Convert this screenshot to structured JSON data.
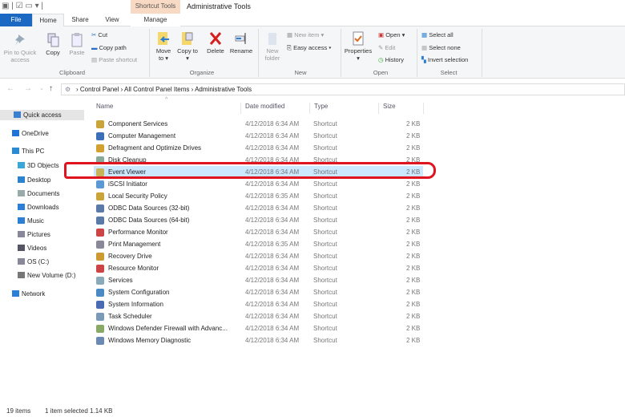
{
  "window": {
    "title": "Administrative Tools",
    "context_tab_group": "Shortcut Tools"
  },
  "tabs": [
    "File",
    "Home",
    "Share",
    "View",
    "Manage"
  ],
  "ribbon": {
    "clipboard": {
      "pin": "Pin to Quick access",
      "copy": "Copy",
      "paste": "Paste",
      "cut": "Cut",
      "copy_path": "Copy path",
      "paste_shortcut": "Paste shortcut",
      "group": "Clipboard"
    },
    "organize": {
      "move_to": "Move to ▾",
      "copy_to": "Copy to ▾",
      "delete": "Delete",
      "rename": "Rename",
      "group": "Organize"
    },
    "new": {
      "new_folder": "New folder",
      "new_item": "New item ▾",
      "easy_access": "Easy access ▾",
      "group": "New"
    },
    "open": {
      "properties": "Properties",
      "open": "Open ▾",
      "edit": "Edit",
      "history": "History",
      "group": "Open"
    },
    "select": {
      "select_all": "Select all",
      "select_none": "Select none",
      "invert": "Invert selection",
      "group": "Select"
    }
  },
  "address": {
    "crumbs": [
      "Control Panel",
      "All Control Panel Items",
      "Administrative Tools"
    ]
  },
  "nav": [
    {
      "label": "Quick access",
      "icon": "star-icon",
      "color": "#3b7fd1",
      "indent": 0
    },
    {
      "label": "OneDrive",
      "icon": "cloud-icon",
      "color": "#1e73d6",
      "indent": 0
    },
    {
      "label": "This PC",
      "icon": "computer-icon",
      "color": "#2a8ad4",
      "indent": 0
    },
    {
      "label": "3D Objects",
      "icon": "cube-icon",
      "color": "#3aa7d8",
      "indent": 1
    },
    {
      "label": "Desktop",
      "icon": "desktop-icon",
      "color": "#2b83d0",
      "indent": 1
    },
    {
      "label": "Documents",
      "icon": "document-icon",
      "color": "#9aa",
      "indent": 1
    },
    {
      "label": "Downloads",
      "icon": "download-icon",
      "color": "#2b7fd6",
      "indent": 1
    },
    {
      "label": "Music",
      "icon": "music-icon",
      "color": "#2b7fd6",
      "indent": 1
    },
    {
      "label": "Pictures",
      "icon": "pictures-icon",
      "color": "#889",
      "indent": 1
    },
    {
      "label": "Videos",
      "icon": "video-icon",
      "color": "#556",
      "indent": 1
    },
    {
      "label": "OS (C:)",
      "icon": "drive-icon",
      "color": "#889",
      "indent": 1
    },
    {
      "label": "New Volume (D:)",
      "icon": "drive-icon",
      "color": "#777",
      "indent": 1
    },
    {
      "label": "Network",
      "icon": "network-icon",
      "color": "#2b7fd6",
      "indent": 0
    }
  ],
  "columns": {
    "name": "Name",
    "date": "Date modified",
    "type": "Type",
    "size": "Size"
  },
  "files": [
    {
      "name": "Component Services",
      "date": "4/12/2018 6:34 AM",
      "type": "Shortcut",
      "size": "2 KB"
    },
    {
      "name": "Computer Management",
      "date": "4/12/2018 6:34 AM",
      "type": "Shortcut",
      "size": "2 KB"
    },
    {
      "name": "Defragment and Optimize Drives",
      "date": "4/12/2018 6:34 AM",
      "type": "Shortcut",
      "size": "2 KB"
    },
    {
      "name": "Disk Cleanup",
      "date": "4/12/2018 6:34 AM",
      "type": "Shortcut",
      "size": "2 KB"
    },
    {
      "name": "Event Viewer",
      "date": "4/12/2018 6:34 AM",
      "type": "Shortcut",
      "size": "2 KB",
      "selected": true
    },
    {
      "name": "iSCSI Initiator",
      "date": "4/12/2018 6:34 AM",
      "type": "Shortcut",
      "size": "2 KB"
    },
    {
      "name": "Local Security Policy",
      "date": "4/12/2018 6:35 AM",
      "type": "Shortcut",
      "size": "2 KB"
    },
    {
      "name": "ODBC Data Sources (32-bit)",
      "date": "4/12/2018 6:34 AM",
      "type": "Shortcut",
      "size": "2 KB"
    },
    {
      "name": "ODBC Data Sources (64-bit)",
      "date": "4/12/2018 6:34 AM",
      "type": "Shortcut",
      "size": "2 KB"
    },
    {
      "name": "Performance Monitor",
      "date": "4/12/2018 6:34 AM",
      "type": "Shortcut",
      "size": "2 KB"
    },
    {
      "name": "Print Management",
      "date": "4/12/2018 6:35 AM",
      "type": "Shortcut",
      "size": "2 KB"
    },
    {
      "name": "Recovery Drive",
      "date": "4/12/2018 6:34 AM",
      "type": "Shortcut",
      "size": "2 KB"
    },
    {
      "name": "Resource Monitor",
      "date": "4/12/2018 6:34 AM",
      "type": "Shortcut",
      "size": "2 KB"
    },
    {
      "name": "Services",
      "date": "4/12/2018 6:34 AM",
      "type": "Shortcut",
      "size": "2 KB"
    },
    {
      "name": "System Configuration",
      "date": "4/12/2018 6:34 AM",
      "type": "Shortcut",
      "size": "2 KB"
    },
    {
      "name": "System Information",
      "date": "4/12/2018 6:34 AM",
      "type": "Shortcut",
      "size": "2 KB"
    },
    {
      "name": "Task Scheduler",
      "date": "4/12/2018 6:34 AM",
      "type": "Shortcut",
      "size": "2 KB"
    },
    {
      "name": "Windows Defender Firewall with Advanc...",
      "date": "4/12/2018 6:34 AM",
      "type": "Shortcut",
      "size": "2 KB"
    },
    {
      "name": "Windows Memory Diagnostic",
      "date": "4/12/2018 6:34 AM",
      "type": "Shortcut",
      "size": "2 KB"
    }
  ],
  "status": {
    "count": "19 items",
    "selection": "1 item selected  1.14 KB"
  },
  "colors": {
    "file_tab": "#1a68c2",
    "selection": "#cce8ff",
    "highlight": "#e0141e",
    "context_tab": "#f7d9c4"
  }
}
